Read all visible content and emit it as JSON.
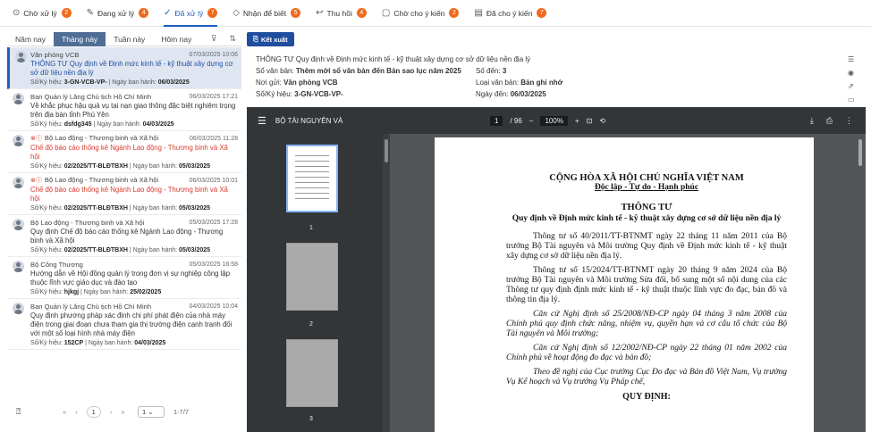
{
  "tabs": [
    {
      "icon": "inbox-icon",
      "glyph": "⊙",
      "label": "Chờ xử lý",
      "count": "2"
    },
    {
      "icon": "pen-icon",
      "glyph": "✎",
      "label": "Đang xử lý",
      "count": "4"
    },
    {
      "icon": "check-circle-icon",
      "glyph": "✓",
      "label": "Đã xử lý",
      "count": "7"
    },
    {
      "icon": "tag-icon",
      "glyph": "◇",
      "label": "Nhận để biết",
      "count": "5"
    },
    {
      "icon": "return-icon",
      "glyph": "↩",
      "label": "Thu hồi",
      "count": "4"
    },
    {
      "icon": "comment-icon",
      "glyph": "▢",
      "label": "Chờ cho ý kiến",
      "count": "2"
    },
    {
      "icon": "document-icon",
      "glyph": "▤",
      "label": "Đã cho ý kiến",
      "count": "7"
    }
  ],
  "filters": [
    "Năm nay",
    "Tháng này",
    "Tuần này",
    "Hôm nay"
  ],
  "items": [
    {
      "org": "Văn phòng VCB",
      "date": "07/03/2025 10:06",
      "title": "THÔNG TƯ Quy định về Định mức kinh tế - kỹ thuật xây dựng cơ sở dữ liệu nền địa lý",
      "meta_label": "Số/Ký hiệu: ",
      "code": "3-GN-VCB-VP-",
      "meta2": " | Ngày ban hành: ",
      "issued": "06/03/2025",
      "flags": "",
      "style": "blue"
    },
    {
      "org": "Ban Quản lý Lăng Chủ tịch Hồ Chí Minh",
      "date": "06/03/2025 17:21",
      "title": "Về khắc phục hậu quả vụ tai nạn giao thông đặc biệt nghiêm trọng trên địa bàn tỉnh Phú Yên",
      "meta_label": "Số/Ký hiệu: ",
      "code": "dsfdg345",
      "meta2": " | Ngày ban hành: ",
      "issued": "04/03/2025",
      "flags": "",
      "style": ""
    },
    {
      "org": "Bộ Lao động - Thương binh và Xã hội",
      "date": "06/03/2025 11:28",
      "title": "Chế độ báo cáo thống kê Ngành Lao động - Thương binh và Xã hội",
      "meta_label": "Số/Ký hiệu: ",
      "code": "02/2025/TT-BLĐTBXH",
      "meta2": " | Ngày ban hành: ",
      "issued": "05/03/2025",
      "flags": "⊗ⓘ",
      "style": "red"
    },
    {
      "org": "Bộ Lao động - Thương binh và Xã hội",
      "date": "06/03/2025 10:01",
      "title": "Chế độ báo cáo thống kê Ngành Lao động - Thương binh và Xã hội",
      "meta_label": "Số/Ký hiệu: ",
      "code": "02/2025/TT-BLĐTBXH",
      "meta2": " | Ngày ban hành: ",
      "issued": "05/03/2025",
      "flags": "⊗ⓘ",
      "style": "red"
    },
    {
      "org": "Bộ Lao động - Thương binh và Xã hội",
      "date": "05/03/2025 17:28",
      "title": "Quy định Chế độ báo cáo thống kê Ngành Lao động - Thương binh và Xã hội",
      "meta_label": "Số/Ký hiệu: ",
      "code": "02/2025/TT-BLĐTBXH",
      "meta2": " | Ngày ban hành: ",
      "issued": "05/03/2025",
      "flags": "",
      "style": ""
    },
    {
      "org": "Bộ Công Thương",
      "date": "05/03/2025 16:58",
      "title": "Hướng dẫn về Hội đồng quản lý trong đơn vị sự nghiệp công lập thuộc lĩnh vực giáo dục và đào tạo",
      "meta_label": "Số/Ký hiệu: ",
      "code": "hjkgj",
      "meta2": " | Ngày ban hành: ",
      "issued": "25/02/2025",
      "flags": "",
      "style": ""
    },
    {
      "org": "Ban Quản lý Lăng Chủ tịch Hồ Chí Minh",
      "date": "04/03/2025 10:04",
      "title": "Quy định phương pháp xác định chi phí phát điện của nhà máy điện trong giai đoạn chưa tham gia thị trường điện cạnh tranh đối với một số loại hình nhà máy điện",
      "meta_label": "Số/Ký hiệu: ",
      "code": "152CP",
      "meta2": " | Ngày ban hành: ",
      "issued": "04/03/2025",
      "flags": "",
      "style": ""
    }
  ],
  "pager": {
    "page": "1",
    "size": "1",
    "range": "1-7/7"
  },
  "export_label": "Kết xuất",
  "info": {
    "title": "THÔNG TƯ Quy định về Định mức kinh tế - kỹ thuật xây dựng cơ sở dữ liệu nền địa lý",
    "so_van_ban_label": "Sổ văn bản: ",
    "so_van_ban": "Thêm mới sổ văn bản đến Bản sao lục năm 2025",
    "so_den_label": "Số đến: ",
    "so_den": "3",
    "noi_gui_label": "Nơi gửi: ",
    "noi_gui": "Văn phòng VCB",
    "loai_label": "Loại văn bản: ",
    "loai": "Bản ghi nhớ",
    "ky_hieu_label": "Số/Ký hiệu: ",
    "ky_hieu": "3-GN-VCB-VP-",
    "ngay_den_label": "Ngày đến: ",
    "ngay_den": "06/03/2025"
  },
  "pdf": {
    "filename": "BỘ TÀI NGUYÊN VÀ",
    "page": "1",
    "total": "/ 96",
    "zoom": "100%",
    "thumb_labels": [
      "1",
      "2",
      "3"
    ],
    "h1": "CỘNG HÒA XÃ HỘI CHỦ NGHĨA VIỆT NAM",
    "h2": "Độc lập - Tự do - Hạnh phúc",
    "h3": "THÔNG TƯ",
    "h4": "Quy định về Định mức kinh tế - kỹ thuật xây dựng cơ sở dữ liệu nền địa lý",
    "p1": "Thông tư số 40/2011/TT-BTNMT ngày 22 tháng 11 năm 2011 của Bộ trưởng Bộ Tài nguyên và Môi trường Quy định về Định mức kinh tế - kỹ thuật xây dựng cơ sở dữ liệu nền địa lý.",
    "p2": "Thông tư số 15/2024/TT-BTNMT ngày 20 tháng 9 năm 2024 của Bộ trưởng Bộ Tài nguyên và Môi trường Sửa đổi, bổ sung một số nội dung của các Thông tư quy định định mức kinh tế - kỹ thuật thuộc lĩnh vực đo đạc, bản đồ và thông tin địa lý.",
    "p3": "Căn cứ Nghị định số 25/2008/NĐ-CP ngày 04 tháng 3 năm 2008 của Chính phủ quy định chức năng, nhiệm vụ, quyền hạn và cơ cấu tổ chức của Bộ Tài nguyên và Môi trường;",
    "p4": "Căn cứ Nghị định số 12/2002/NĐ-CP ngày 22 tháng 01 năm 2002 của Chính phủ về hoạt động đo đạc và bản đồ;",
    "p5": "Theo đề nghị của Cục trưởng Cục Đo đạc và Bản đồ Việt Nam, Vụ trưởng Vụ Kế hoạch và Vụ trưởng Vụ Pháp chế,",
    "h5": "QUY ĐỊNH:"
  }
}
